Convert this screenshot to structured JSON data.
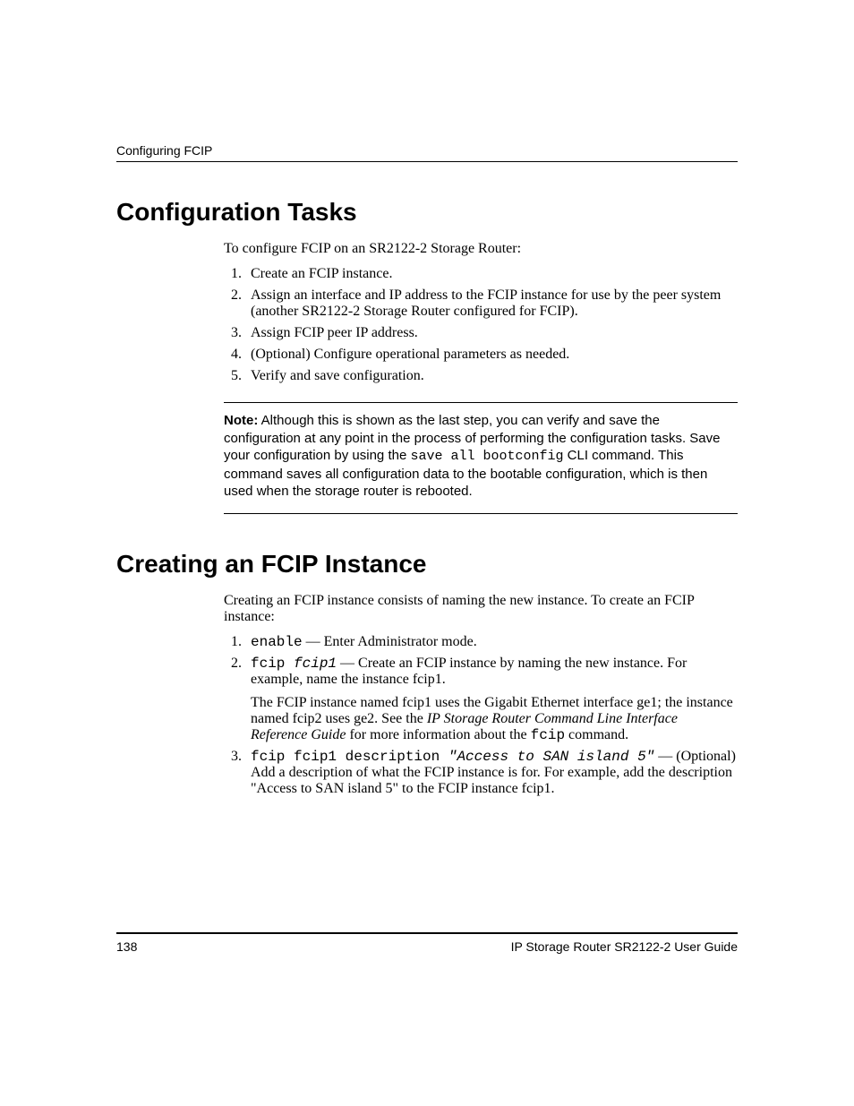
{
  "header": {
    "running": "Configuring FCIP"
  },
  "section1": {
    "heading": "Configuration Tasks",
    "intro": "To configure FCIP on an SR2122-2 Storage Router:",
    "steps": [
      "Create an FCIP  instance.",
      "Assign an interface and IP address to the FCIP instance for use by the peer system (another SR2122-2 Storage Router configured for FCIP).",
      "Assign FCIP peer IP address.",
      "(Optional) Configure operational parameters as needed.",
      "Verify and save configuration."
    ],
    "note": {
      "label": "Note:",
      "pre": "Although this is shown as the last step, you can verify and save the configuration at any point in the process of performing the configuration tasks. Save your configuration by using the ",
      "cmd": "save all bootconfig",
      "post": " CLI command. This command saves all configuration data to the bootable configuration, which is then used when the storage router is rebooted."
    }
  },
  "section2": {
    "heading": "Creating an FCIP Instance",
    "intro": "Creating an FCIP instance consists of naming the new instance. To create an FCIP instance:",
    "step1": {
      "cmd": "enable",
      "text": " — Enter Administrator mode."
    },
    "step2": {
      "cmd1": "fcip ",
      "cmdArg": "fcip1",
      "text": " — Create an FCIP instance by naming the new instance. For example, name the instance fcip1.",
      "para_pre": "The FCIP instance named fcip1 uses the Gigabit Ethernet interface ge1; the instance named fcip2 uses ge2. See the ",
      "para_ital": "IP Storage Router Command Line Interface Reference Guide",
      "para_mid": " for more information about the ",
      "para_cmd": "fcip",
      "para_post": " command."
    },
    "step3": {
      "cmd": "fcip fcip1 description ",
      "cmdArg": "\"Access to SAN island 5\"",
      "text": " — (Optional) Add a description of what the FCIP instance is for. For example, add the description \"Access to SAN island 5\" to the FCIP instance fcip1."
    }
  },
  "footer": {
    "page": "138",
    "title": "IP Storage Router SR2122-2 User Guide"
  }
}
